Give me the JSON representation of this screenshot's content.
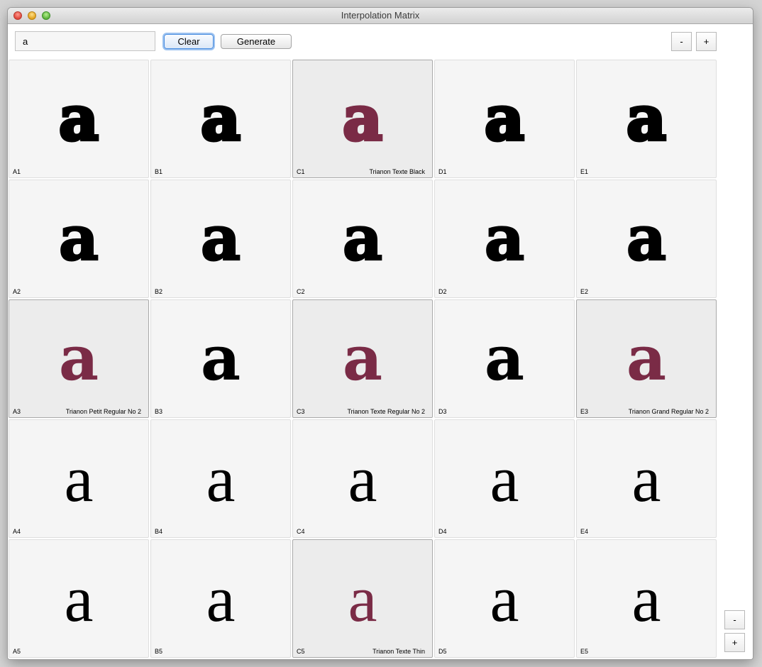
{
  "window": {
    "title": "Interpolation Matrix"
  },
  "toolbar": {
    "glyph_value": "a",
    "clear_label": "Clear",
    "generate_label": "Generate",
    "zoom_minus_label": "-",
    "zoom_plus_label": "+"
  },
  "side_controls": {
    "minus_label": "-",
    "plus_label": "+"
  },
  "colors": {
    "master_glyph": "#7a2b46",
    "glyph": "#000000"
  },
  "matrix": {
    "columns": [
      "A",
      "B",
      "C",
      "D",
      "E"
    ],
    "rows": [
      1,
      2,
      3,
      4,
      5
    ],
    "cells": [
      {
        "id": "A1",
        "name": "",
        "glyph": "a",
        "master": false,
        "row": 0
      },
      {
        "id": "B1",
        "name": "",
        "glyph": "a",
        "master": false,
        "row": 0
      },
      {
        "id": "C1",
        "name": "Trianon Texte Black",
        "glyph": "a",
        "master": true,
        "row": 0
      },
      {
        "id": "D1",
        "name": "",
        "glyph": "a",
        "master": false,
        "row": 0
      },
      {
        "id": "E1",
        "name": "",
        "glyph": "a",
        "master": false,
        "row": 0
      },
      {
        "id": "A2",
        "name": "",
        "glyph": "a",
        "master": false,
        "row": 1
      },
      {
        "id": "B2",
        "name": "",
        "glyph": "a",
        "master": false,
        "row": 1
      },
      {
        "id": "C2",
        "name": "",
        "glyph": "a",
        "master": false,
        "row": 1
      },
      {
        "id": "D2",
        "name": "",
        "glyph": "a",
        "master": false,
        "row": 1
      },
      {
        "id": "E2",
        "name": "",
        "glyph": "a",
        "master": false,
        "row": 1
      },
      {
        "id": "A3",
        "name": "Trianon Petit Regular No 2",
        "glyph": "a",
        "master": true,
        "row": 2
      },
      {
        "id": "B3",
        "name": "",
        "glyph": "a",
        "master": false,
        "row": 2
      },
      {
        "id": "C3",
        "name": "Trianon Texte Regular No 2",
        "glyph": "a",
        "master": true,
        "row": 2
      },
      {
        "id": "D3",
        "name": "",
        "glyph": "a",
        "master": false,
        "row": 2
      },
      {
        "id": "E3",
        "name": "Trianon Grand Regular No 2",
        "glyph": "a",
        "master": true,
        "row": 2
      },
      {
        "id": "A4",
        "name": "",
        "glyph": "a",
        "master": false,
        "row": 3
      },
      {
        "id": "B4",
        "name": "",
        "glyph": "a",
        "master": false,
        "row": 3
      },
      {
        "id": "C4",
        "name": "",
        "glyph": "a",
        "master": false,
        "row": 3
      },
      {
        "id": "D4",
        "name": "",
        "glyph": "a",
        "master": false,
        "row": 3
      },
      {
        "id": "E4",
        "name": "",
        "glyph": "a",
        "master": false,
        "row": 3
      },
      {
        "id": "A5",
        "name": "",
        "glyph": "a",
        "master": false,
        "row": 4
      },
      {
        "id": "B5",
        "name": "",
        "glyph": "a",
        "master": false,
        "row": 4
      },
      {
        "id": "C5",
        "name": "Trianon Texte Thin",
        "glyph": "a",
        "master": true,
        "row": 4
      },
      {
        "id": "D5",
        "name": "",
        "glyph": "a",
        "master": false,
        "row": 4
      },
      {
        "id": "E5",
        "name": "",
        "glyph": "a",
        "master": false,
        "row": 4
      }
    ]
  }
}
